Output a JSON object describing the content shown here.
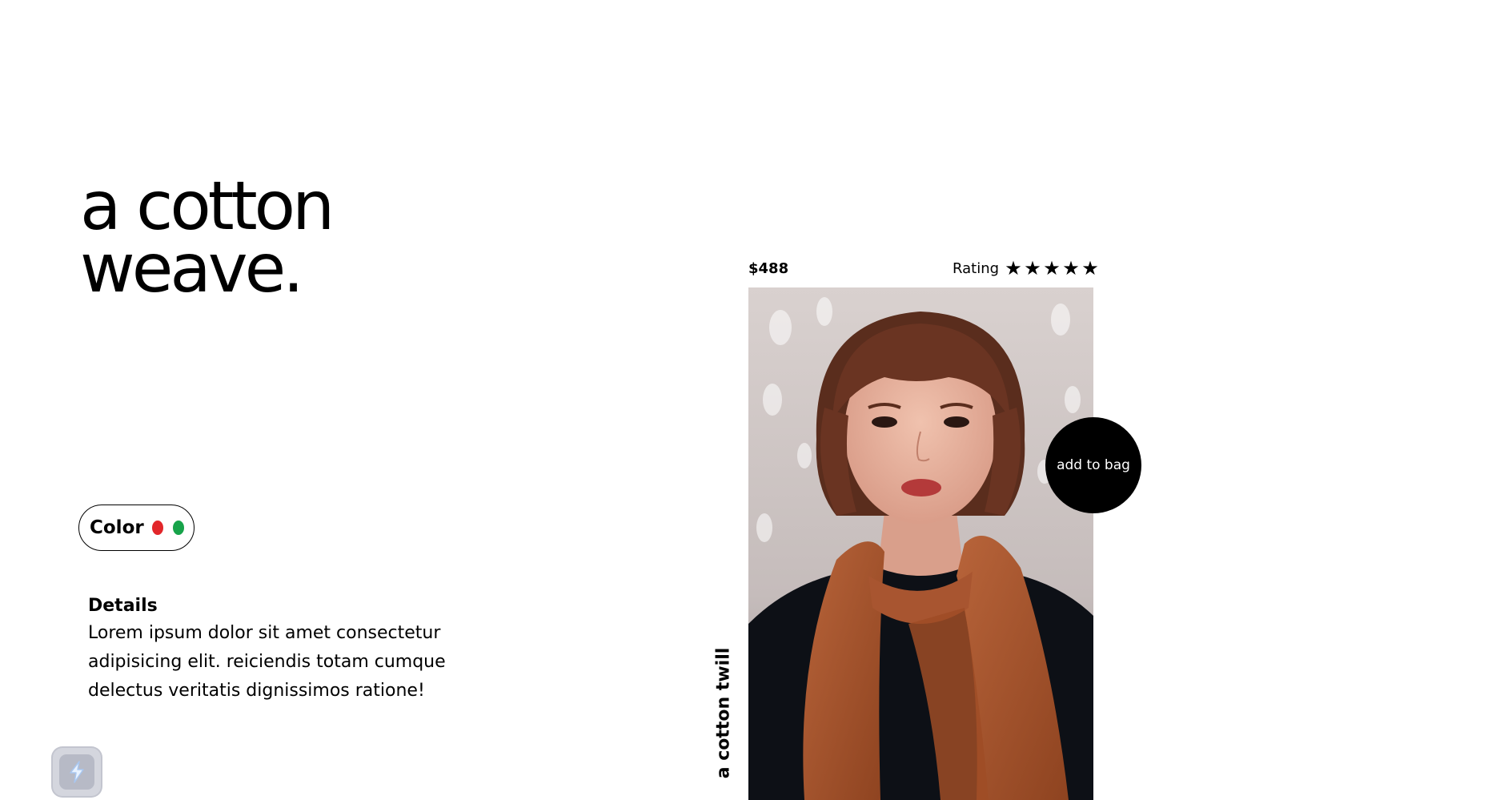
{
  "product": {
    "title_line1": "a cotton",
    "title_line2": "weave.",
    "price": "$488",
    "rating_label": "Rating",
    "rating": 5,
    "rating_max": 5,
    "vertical_caption": "a cotton twill",
    "add_to_bag_label": "add to bag"
  },
  "color": {
    "label": "Color",
    "swatches": [
      {
        "name": "red",
        "hex": "#e2262a"
      },
      {
        "name": "green",
        "hex": "#17a34a"
      }
    ]
  },
  "details": {
    "heading": "Details",
    "body": "Lorem ipsum dolor sit amet consectetur adipisicing elit. reiciendis totam cumque delectus veritatis dignissimos ratione!"
  },
  "icons": {
    "star": "star-icon",
    "widget": "lightning-icon"
  }
}
